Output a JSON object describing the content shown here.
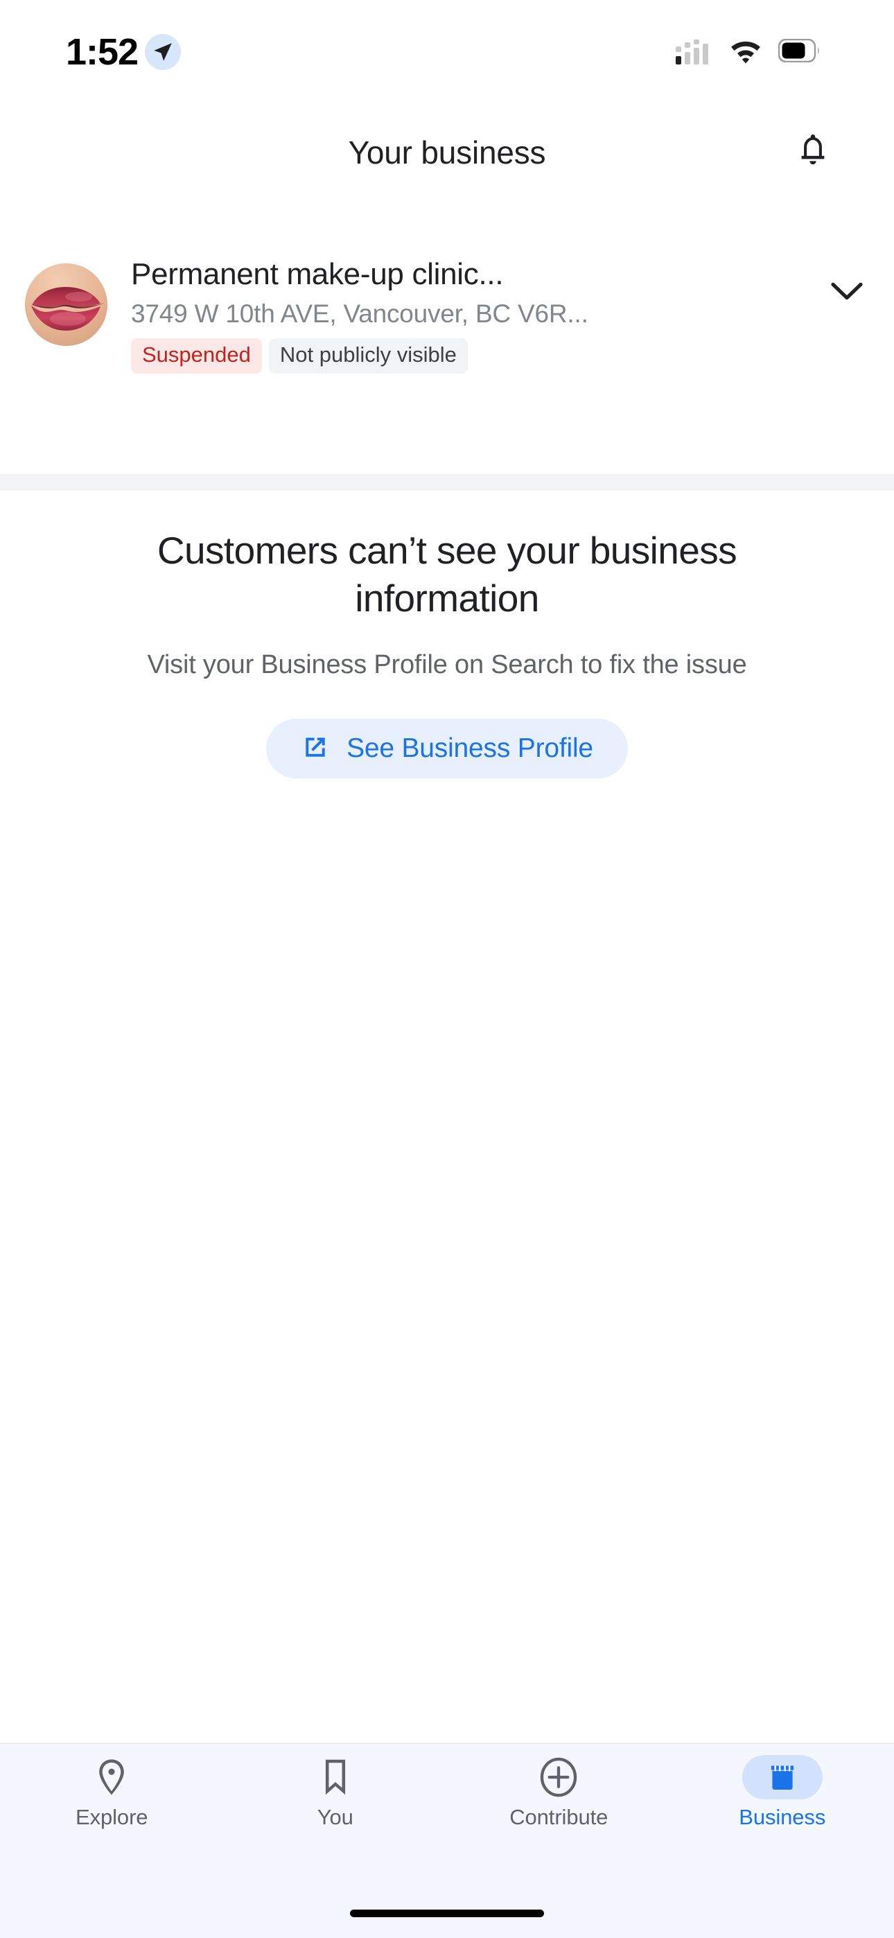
{
  "status_bar": {
    "time": "1:52",
    "location_icon": "location-arrow-icon",
    "cellular_icon": "cellular-signal-icon",
    "wifi_icon": "wifi-icon",
    "battery_icon": "battery-icon"
  },
  "header": {
    "title": "Your business",
    "notifications_icon": "bell-icon"
  },
  "business": {
    "avatar_alt": "business-profile-photo",
    "name": "Permanent make-up clinic...",
    "address": "3749 W 10th AVE, Vancouver, BC V6R...",
    "badges": [
      {
        "label": "Suspended",
        "type": "suspended",
        "text_color": "#C5221F",
        "bg_color": "#FCE8E6"
      },
      {
        "label": "Not publicly visible",
        "type": "visibility",
        "text_color": "#3C4043",
        "bg_color": "#F1F3F4"
      }
    ],
    "expand_icon": "chevron-down-icon"
  },
  "empty_state": {
    "title": "Customers can’t see your business information",
    "subtitle": "Visit your Business Profile on Search to fix the issue",
    "cta": {
      "label": "See Business Profile",
      "icon": "external-link-icon",
      "text_color": "#1A73E8",
      "bg_color": "#E8F0FE"
    }
  },
  "bottom_nav": {
    "active_color": "#1A73E8",
    "inactive_color": "#5F6368",
    "items": [
      {
        "label": "Explore",
        "icon": "map-pin-icon",
        "active": false
      },
      {
        "label": "You",
        "icon": "bookmark-icon",
        "active": false
      },
      {
        "label": "Contribute",
        "icon": "plus-circle-icon",
        "active": false
      },
      {
        "label": "Business",
        "icon": "storefront-icon",
        "active": true
      }
    ]
  }
}
